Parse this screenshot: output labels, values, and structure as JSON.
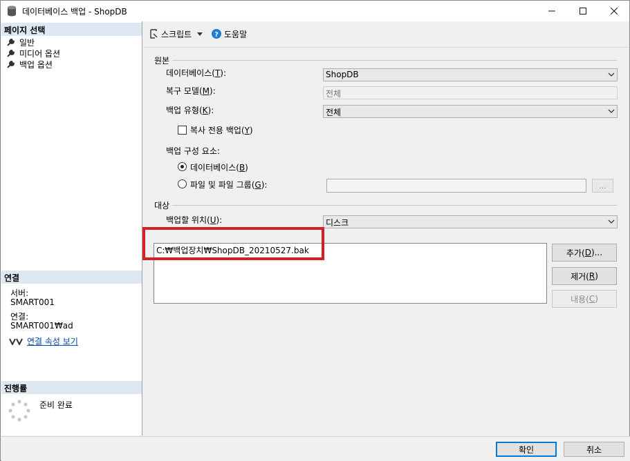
{
  "window": {
    "title": "데이터베이스 백업 - ShopDB"
  },
  "left": {
    "page_select_header": "페이지 선택",
    "pages": [
      {
        "label": "일반"
      },
      {
        "label": "미디어 옵션"
      },
      {
        "label": "백업 옵션"
      }
    ],
    "connection_header": "연결",
    "server_label": "서버:",
    "server_value": "SMART001",
    "connection_label": "연결:",
    "connection_value": "SMART001₩ad",
    "view_props_link": "연결 속성 보기",
    "progress_header": "진행률",
    "progress_status": "준비 완료"
  },
  "toolbar": {
    "script_label": "스크립트",
    "help_label": "도움말"
  },
  "source": {
    "group_label": "원본",
    "database_label": "데이터베이스(",
    "database_key": "T",
    "database_value": "ShopDB",
    "recovery_label": "복구 모델(",
    "recovery_key": "M",
    "recovery_value": "전체",
    "backup_type_label": "백업 유형(",
    "backup_type_key": "K",
    "backup_type_value": "전체",
    "copy_only_label": "복사 전용 백업(",
    "copy_only_key": "Y",
    "component_label": "백업 구성 요소:",
    "radio_db_label": "데이터베이스(",
    "radio_db_key": "B",
    "radio_files_label": "파일 및 파일 그룹(",
    "radio_files_key": "G",
    "browse_label": "..."
  },
  "destination": {
    "group_label": "대상",
    "backup_to_label": "백업할 위치(",
    "backup_to_key": "U",
    "backup_to_value": "디스크",
    "files": [
      "C:₩백업장치₩ShopDB_20210527.bak"
    ],
    "add_label": "추가(",
    "add_key": "D",
    "remove_label": "제거(",
    "remove_key": "R",
    "contents_label": "내용(",
    "contents_key": "C"
  },
  "footer": {
    "ok_label": "확인",
    "cancel_label": "취소"
  },
  "colors": {
    "highlight": "#d42027",
    "header_bg": "#dde8f2",
    "link": "#0645ad",
    "default_btn": "#0078d7"
  }
}
